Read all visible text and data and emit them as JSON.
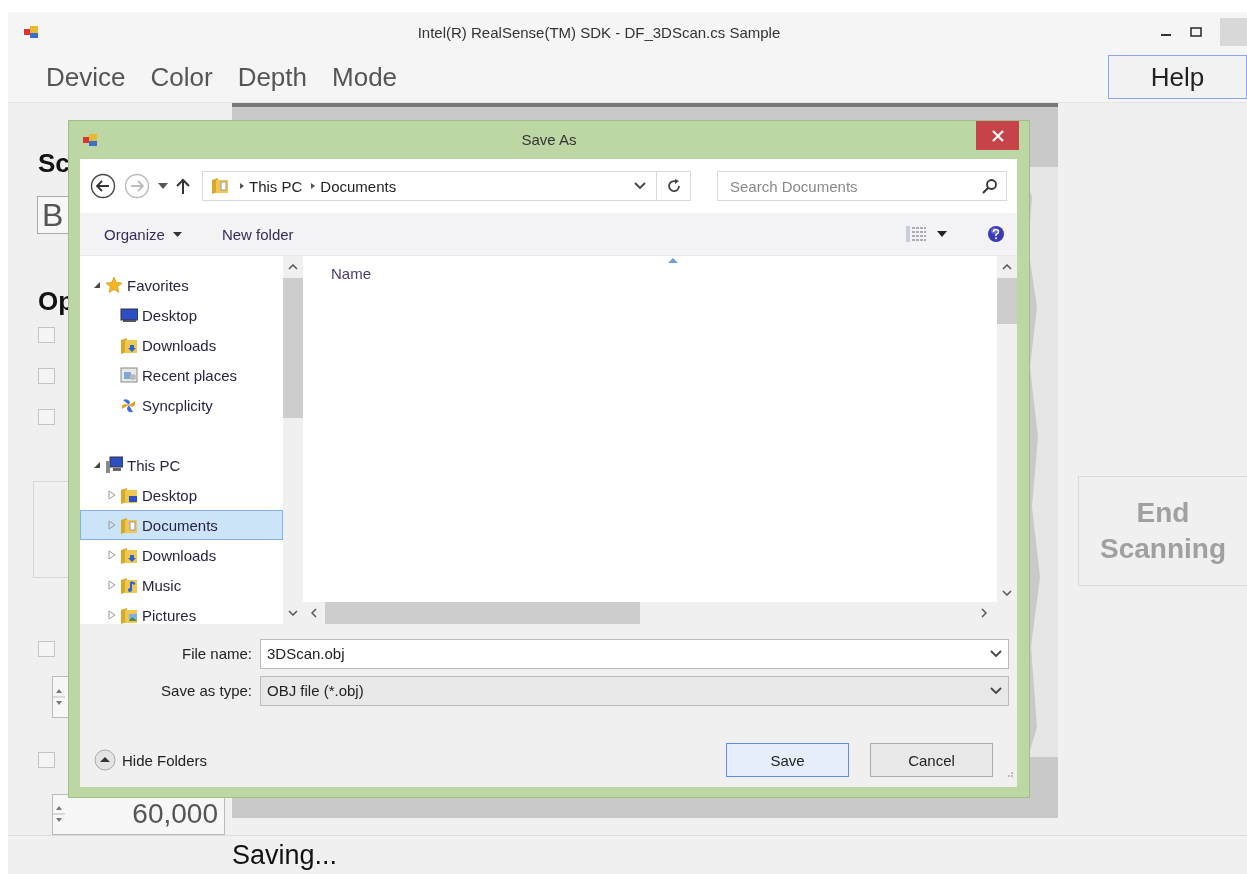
{
  "window": {
    "title": "Intel(R) RealSense(TM) SDK - DF_3DScan.cs Sample"
  },
  "menu": [
    {
      "label": "Device"
    },
    {
      "label": "Color"
    },
    {
      "label": "Depth"
    },
    {
      "label": "Mode"
    }
  ],
  "help_button": {
    "label": "Help"
  },
  "left_panel": [
    {
      "kind": "heading",
      "text": "Sc"
    },
    {
      "kind": "field",
      "value": "B"
    },
    {
      "kind": "heading",
      "text": "Op"
    },
    {
      "kind": "checkbox",
      "checked": false
    },
    {
      "kind": "checkbox",
      "checked": false
    },
    {
      "kind": "checkbox",
      "checked": false
    },
    {
      "kind": "group"
    },
    {
      "kind": "checkbox",
      "checked": false
    },
    {
      "kind": "spinner"
    },
    {
      "kind": "checkbox",
      "checked": false
    },
    {
      "kind": "spinner",
      "value": "60,000"
    }
  ],
  "end_button": {
    "label": "End Scanning",
    "disabled": true
  },
  "status_bar": {
    "text": "Saving..."
  },
  "dialog": {
    "title": "Save As",
    "address": [
      "This PC",
      "Documents"
    ],
    "search": {
      "placeholder": "Search Documents"
    },
    "toolbar": [
      {
        "label": "Organize",
        "dropdown": true
      },
      {
        "label": "New folder",
        "dropdown": false
      }
    ],
    "tree": [
      {
        "label": "Favorites",
        "expanded": true,
        "selected": false,
        "children": [
          {
            "label": "Desktop",
            "selected": false
          },
          {
            "label": "Downloads",
            "selected": false
          },
          {
            "label": "Recent places",
            "selected": false
          },
          {
            "label": "Syncplicity",
            "selected": false
          }
        ]
      },
      {
        "label": "This PC",
        "expanded": true,
        "selected": false,
        "children": [
          {
            "label": "Desktop",
            "expanded": false,
            "selected": false
          },
          {
            "label": "Documents",
            "expanded": false,
            "selected": true
          },
          {
            "label": "Downloads",
            "expanded": false,
            "selected": false
          },
          {
            "label": "Music",
            "expanded": false,
            "selected": false
          },
          {
            "label": "Pictures",
            "expanded": false,
            "selected": false
          }
        ]
      }
    ],
    "columns": [
      {
        "label": "Name"
      }
    ],
    "file_name": {
      "label": "File name:",
      "value": "3DScan.obj"
    },
    "save_type": {
      "label": "Save as type:",
      "value": "OBJ file (*.obj)"
    },
    "hide_folders": {
      "label": "Hide Folders"
    },
    "buttons": [
      {
        "label": "Save",
        "default": true
      },
      {
        "label": "Cancel",
        "default": false
      }
    ]
  }
}
